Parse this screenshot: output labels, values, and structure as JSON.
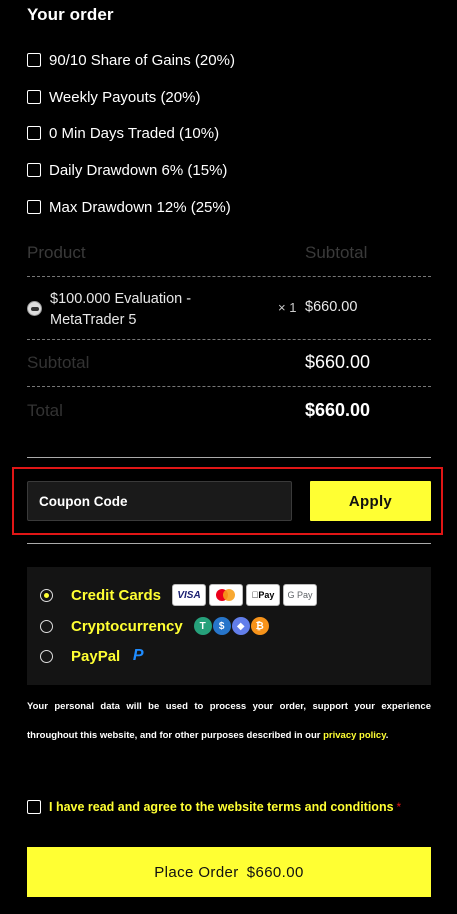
{
  "order": {
    "title": "Your order",
    "addons": [
      {
        "label": "90/10 Share of Gains (20%)",
        "checked": false
      },
      {
        "label": "Weekly Payouts (20%)",
        "checked": false
      },
      {
        "label": "0 Min Days Traded (10%)",
        "checked": false
      },
      {
        "label": "Daily Drawdown 6% (15%)",
        "checked": false
      },
      {
        "label": "Max Drawdown 12% (25%)",
        "checked": false
      }
    ],
    "table": {
      "col_product": "Product",
      "col_subtotal": "Subtotal",
      "item": {
        "name": "$100.000 Evaluation - MetaTrader 5",
        "qty": "× 1",
        "price": "$660.00"
      },
      "subtotal_label": "Subtotal",
      "subtotal_value": "$660.00",
      "total_label": "Total",
      "total_value": "$660.00"
    }
  },
  "coupon": {
    "placeholder": "Coupon Code",
    "apply_label": "Apply"
  },
  "payment": {
    "methods": [
      {
        "label": "Credit Cards",
        "selected": true,
        "icons": [
          "visa-icon",
          "mastercard-icon",
          "apple-pay-icon",
          "google-pay-icon"
        ]
      },
      {
        "label": "Cryptocurrency",
        "selected": false,
        "icons": [
          "tether-icon",
          "usdc-icon",
          "ethereum-icon",
          "bitcoin-icon"
        ]
      },
      {
        "label": "PayPal",
        "selected": false,
        "icons": [
          "paypal-icon"
        ]
      }
    ],
    "card_text": {
      "visa": "VISA",
      "applepay": "Pay",
      "gpay": "G Pay"
    }
  },
  "privacy": {
    "text": "Your personal data will be used to process your order, support your experience throughout this website, and for other purposes described in our",
    "link": "privacy policy",
    "end": "."
  },
  "terms": {
    "label": "I have read and agree to the website terms and conditions",
    "required": "*"
  },
  "place_order": {
    "label": "Place Order",
    "amount": "$660.00"
  },
  "colors": {
    "accent": "#ffff33",
    "background": "#000000",
    "highlight_border": "#e01616"
  }
}
